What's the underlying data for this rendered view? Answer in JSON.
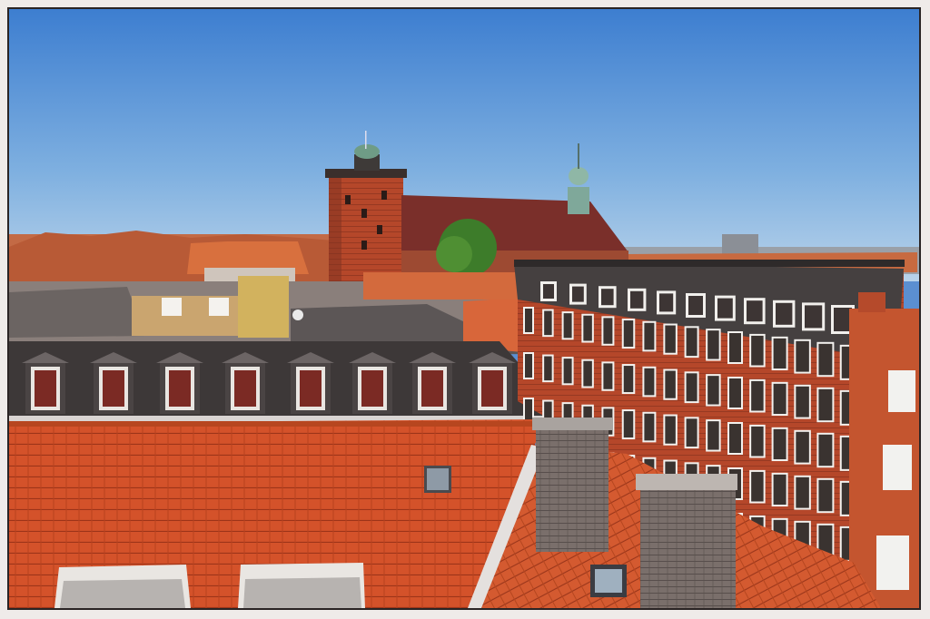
{
  "image": {
    "kind": "photograph",
    "subject": "rooftops-cityscape",
    "colors": {
      "sky_top": "#3f7fd1",
      "sky_bottom": "#aecbe6",
      "tile_roof": "#d8552c",
      "red_brick": "#b4452a",
      "slate_roof": "#3e3a3a",
      "copper_green": "#7fa89a",
      "frame": "#2a2424"
    }
  }
}
